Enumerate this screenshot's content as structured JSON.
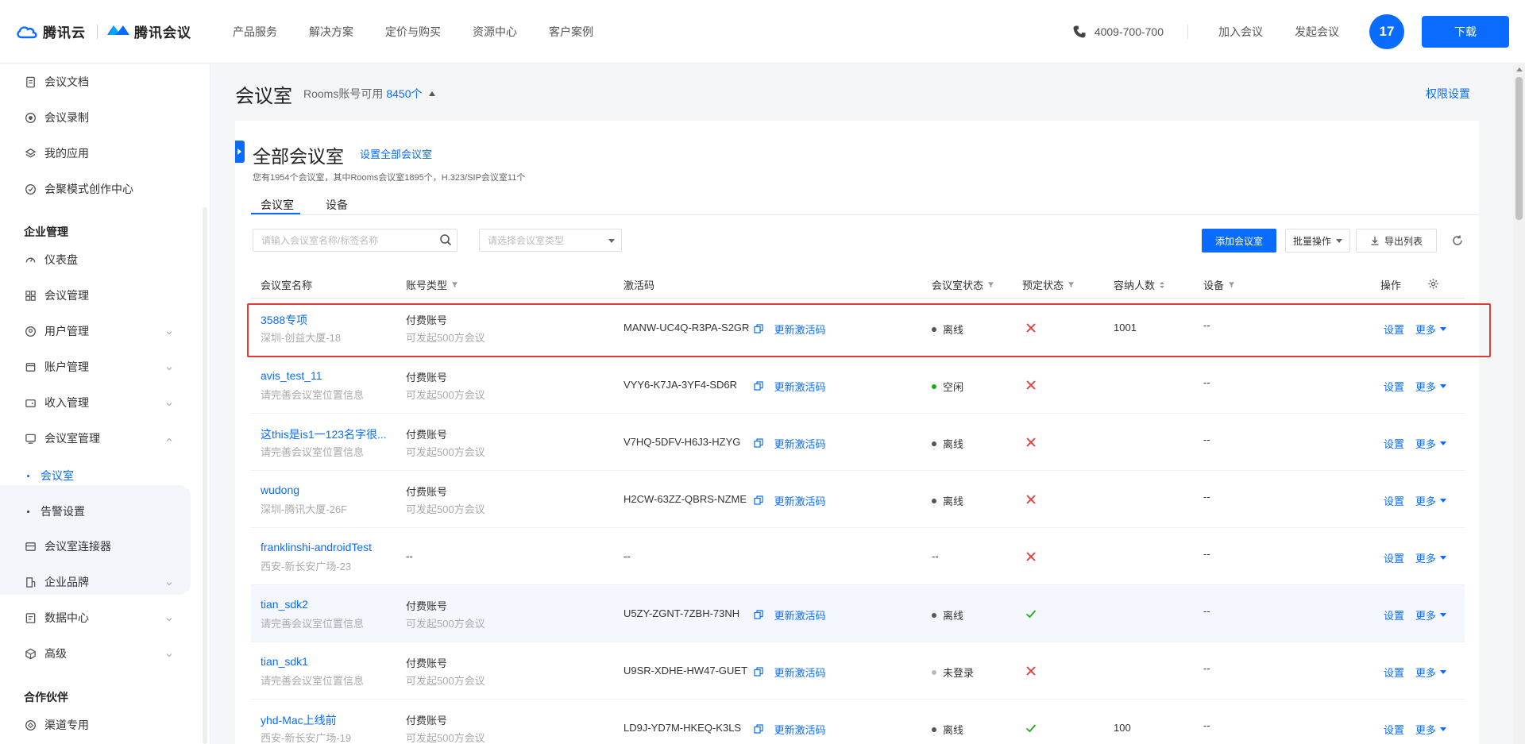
{
  "brand": {
    "cloud_name": "腾讯云",
    "meeting_name": "腾讯会议"
  },
  "topnav": [
    "产品服务",
    "解决方案",
    "定价与购买",
    "资源中心",
    "客户案例"
  ],
  "header": {
    "phone": "4009-700-700",
    "join": "加入会议",
    "start": "发起会议",
    "avatar_text": "17",
    "download": "下载"
  },
  "sidebar": {
    "top_items": [
      "会议文档",
      "会议录制",
      "我的应用",
      "会聚模式创作中心"
    ],
    "section_enterprise": "企业管理",
    "enterprise_items": [
      "仪表盘",
      "会议管理",
      "用户管理",
      "账户管理",
      "收入管理",
      "会议室管理"
    ],
    "room_sub": [
      "会议室",
      "告警设置"
    ],
    "more_items": [
      "会议室连接器",
      "企业品牌",
      "数据中心",
      "高级"
    ],
    "section_partner": "合作伙伴",
    "partner_items": [
      "渠道专用"
    ]
  },
  "page": {
    "title": "会议室",
    "quota_label": "Rooms账号可用",
    "quota_value": "8450个",
    "perm": "权限设置"
  },
  "card": {
    "title": "全部会议室",
    "setall": "设置全部会议室",
    "summary": "您有1954个会议室，其中Rooms会议室1895个，H.323/SIP会议室11个",
    "tabs": [
      "会议室",
      "设备"
    ],
    "search_placeholder": "请输入会议室名称/标签名称",
    "select_placeholder": "请选择会议室类型",
    "add_btn": "添加会议室",
    "batch_btn": "批量操作",
    "export_btn": "导出列表"
  },
  "table": {
    "headers": [
      "会议室名称",
      "账号类型",
      "激活码",
      "会议室状态",
      "预定状态",
      "容纳人数",
      "设备",
      "操作"
    ],
    "refresh_label": "更新激活码",
    "op_set": "设置",
    "op_more": "更多",
    "rows": [
      {
        "name": "3588专项",
        "loc": "深圳-创益大厦-18",
        "type": "付费账号",
        "type_sub": "可发起500方会议",
        "code": "MANW-UC4Q-R3PA-S2GR",
        "status": "离线",
        "status_color": "#555555",
        "booked": false,
        "capacity": "1001",
        "device": "--"
      },
      {
        "name": "avis_test_11",
        "loc": "请完善会议室位置信息",
        "type": "付费账号",
        "type_sub": "可发起500方会议",
        "code": "VYY6-K7JA-3YF4-SD6R",
        "status": "空闲",
        "status_color": "#1aad19",
        "booked": false,
        "capacity": "",
        "device": "--"
      },
      {
        "name": "这this是is1一123名字很...",
        "loc": "请完善会议室位置信息",
        "type": "付费账号",
        "type_sub": "可发起500方会议",
        "code": "V7HQ-5DFV-H6J3-HZYG",
        "status": "离线",
        "status_color": "#555555",
        "booked": false,
        "capacity": "",
        "device": "--"
      },
      {
        "name": "wudong",
        "loc": "深圳-腾讯大厦-26F",
        "type": "付费账号",
        "type_sub": "可发起500方会议",
        "code": "H2CW-63ZZ-QBRS-NZME",
        "status": "离线",
        "status_color": "#555555",
        "booked": false,
        "capacity": "",
        "device": "--"
      },
      {
        "name": "franklinshi-androidTest",
        "loc": "西安-新长安广场-23",
        "type": "--",
        "type_sub": "",
        "code": "--",
        "status": "--",
        "status_color": "",
        "booked": false,
        "capacity": "",
        "device": "--"
      },
      {
        "name": "tian_sdk2",
        "loc": "请完善会议室位置信息",
        "type": "付费账号",
        "type_sub": "可发起500方会议",
        "code": "U5ZY-ZGNT-7ZBH-73NH",
        "status": "离线",
        "status_color": "#555555",
        "booked": true,
        "capacity": "",
        "device": "--"
      },
      {
        "name": "tian_sdk1",
        "loc": "请完善会议室位置信息",
        "type": "付费账号",
        "type_sub": "可发起500方会议",
        "code": "U9SR-XDHE-HW47-GUET",
        "status": "未登录",
        "status_color": "#bbbbbb",
        "booked": false,
        "capacity": "",
        "device": "--"
      },
      {
        "name": "yhd-Mac上线前",
        "loc": "西安-新长安广场-19",
        "type": "付费账号",
        "type_sub": "可发起500方会议",
        "code": "LD9J-YD7M-HKEQ-K3LS",
        "status": "离线",
        "status_color": "#555555",
        "booked": true,
        "capacity": "100",
        "device": "--"
      }
    ]
  },
  "colors": {
    "accent": "#0a6cff",
    "error": "#e53935",
    "success": "#1aad19"
  }
}
